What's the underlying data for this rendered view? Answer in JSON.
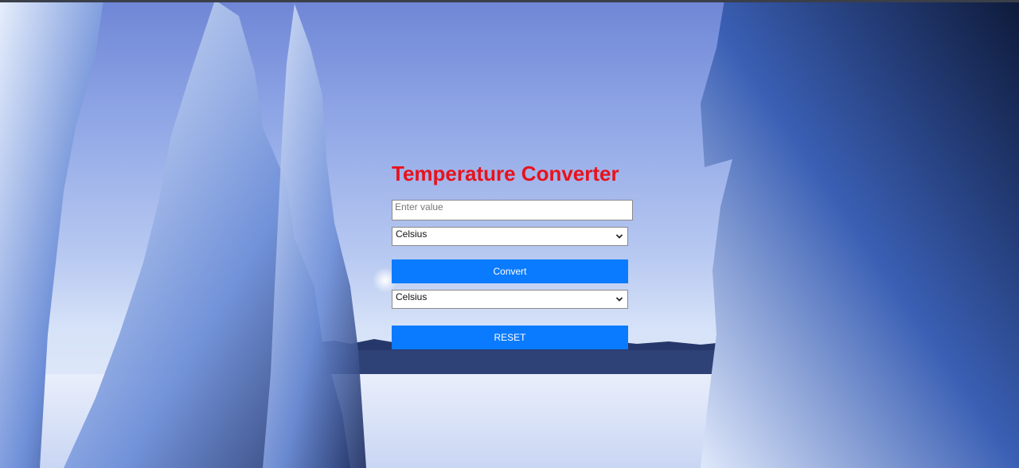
{
  "app": {
    "title": "Temperature Converter"
  },
  "form": {
    "input_placeholder": "Enter value",
    "input_value": "",
    "from_unit": "Celsius",
    "to_unit": "Celsius",
    "convert_label": "Convert",
    "reset_label": "RESET"
  },
  "icons": {
    "dropdown": "chevron-down-icon"
  },
  "colors": {
    "title": "#e8121c",
    "button": "#0a7bff",
    "button_text": "#ffffff"
  }
}
